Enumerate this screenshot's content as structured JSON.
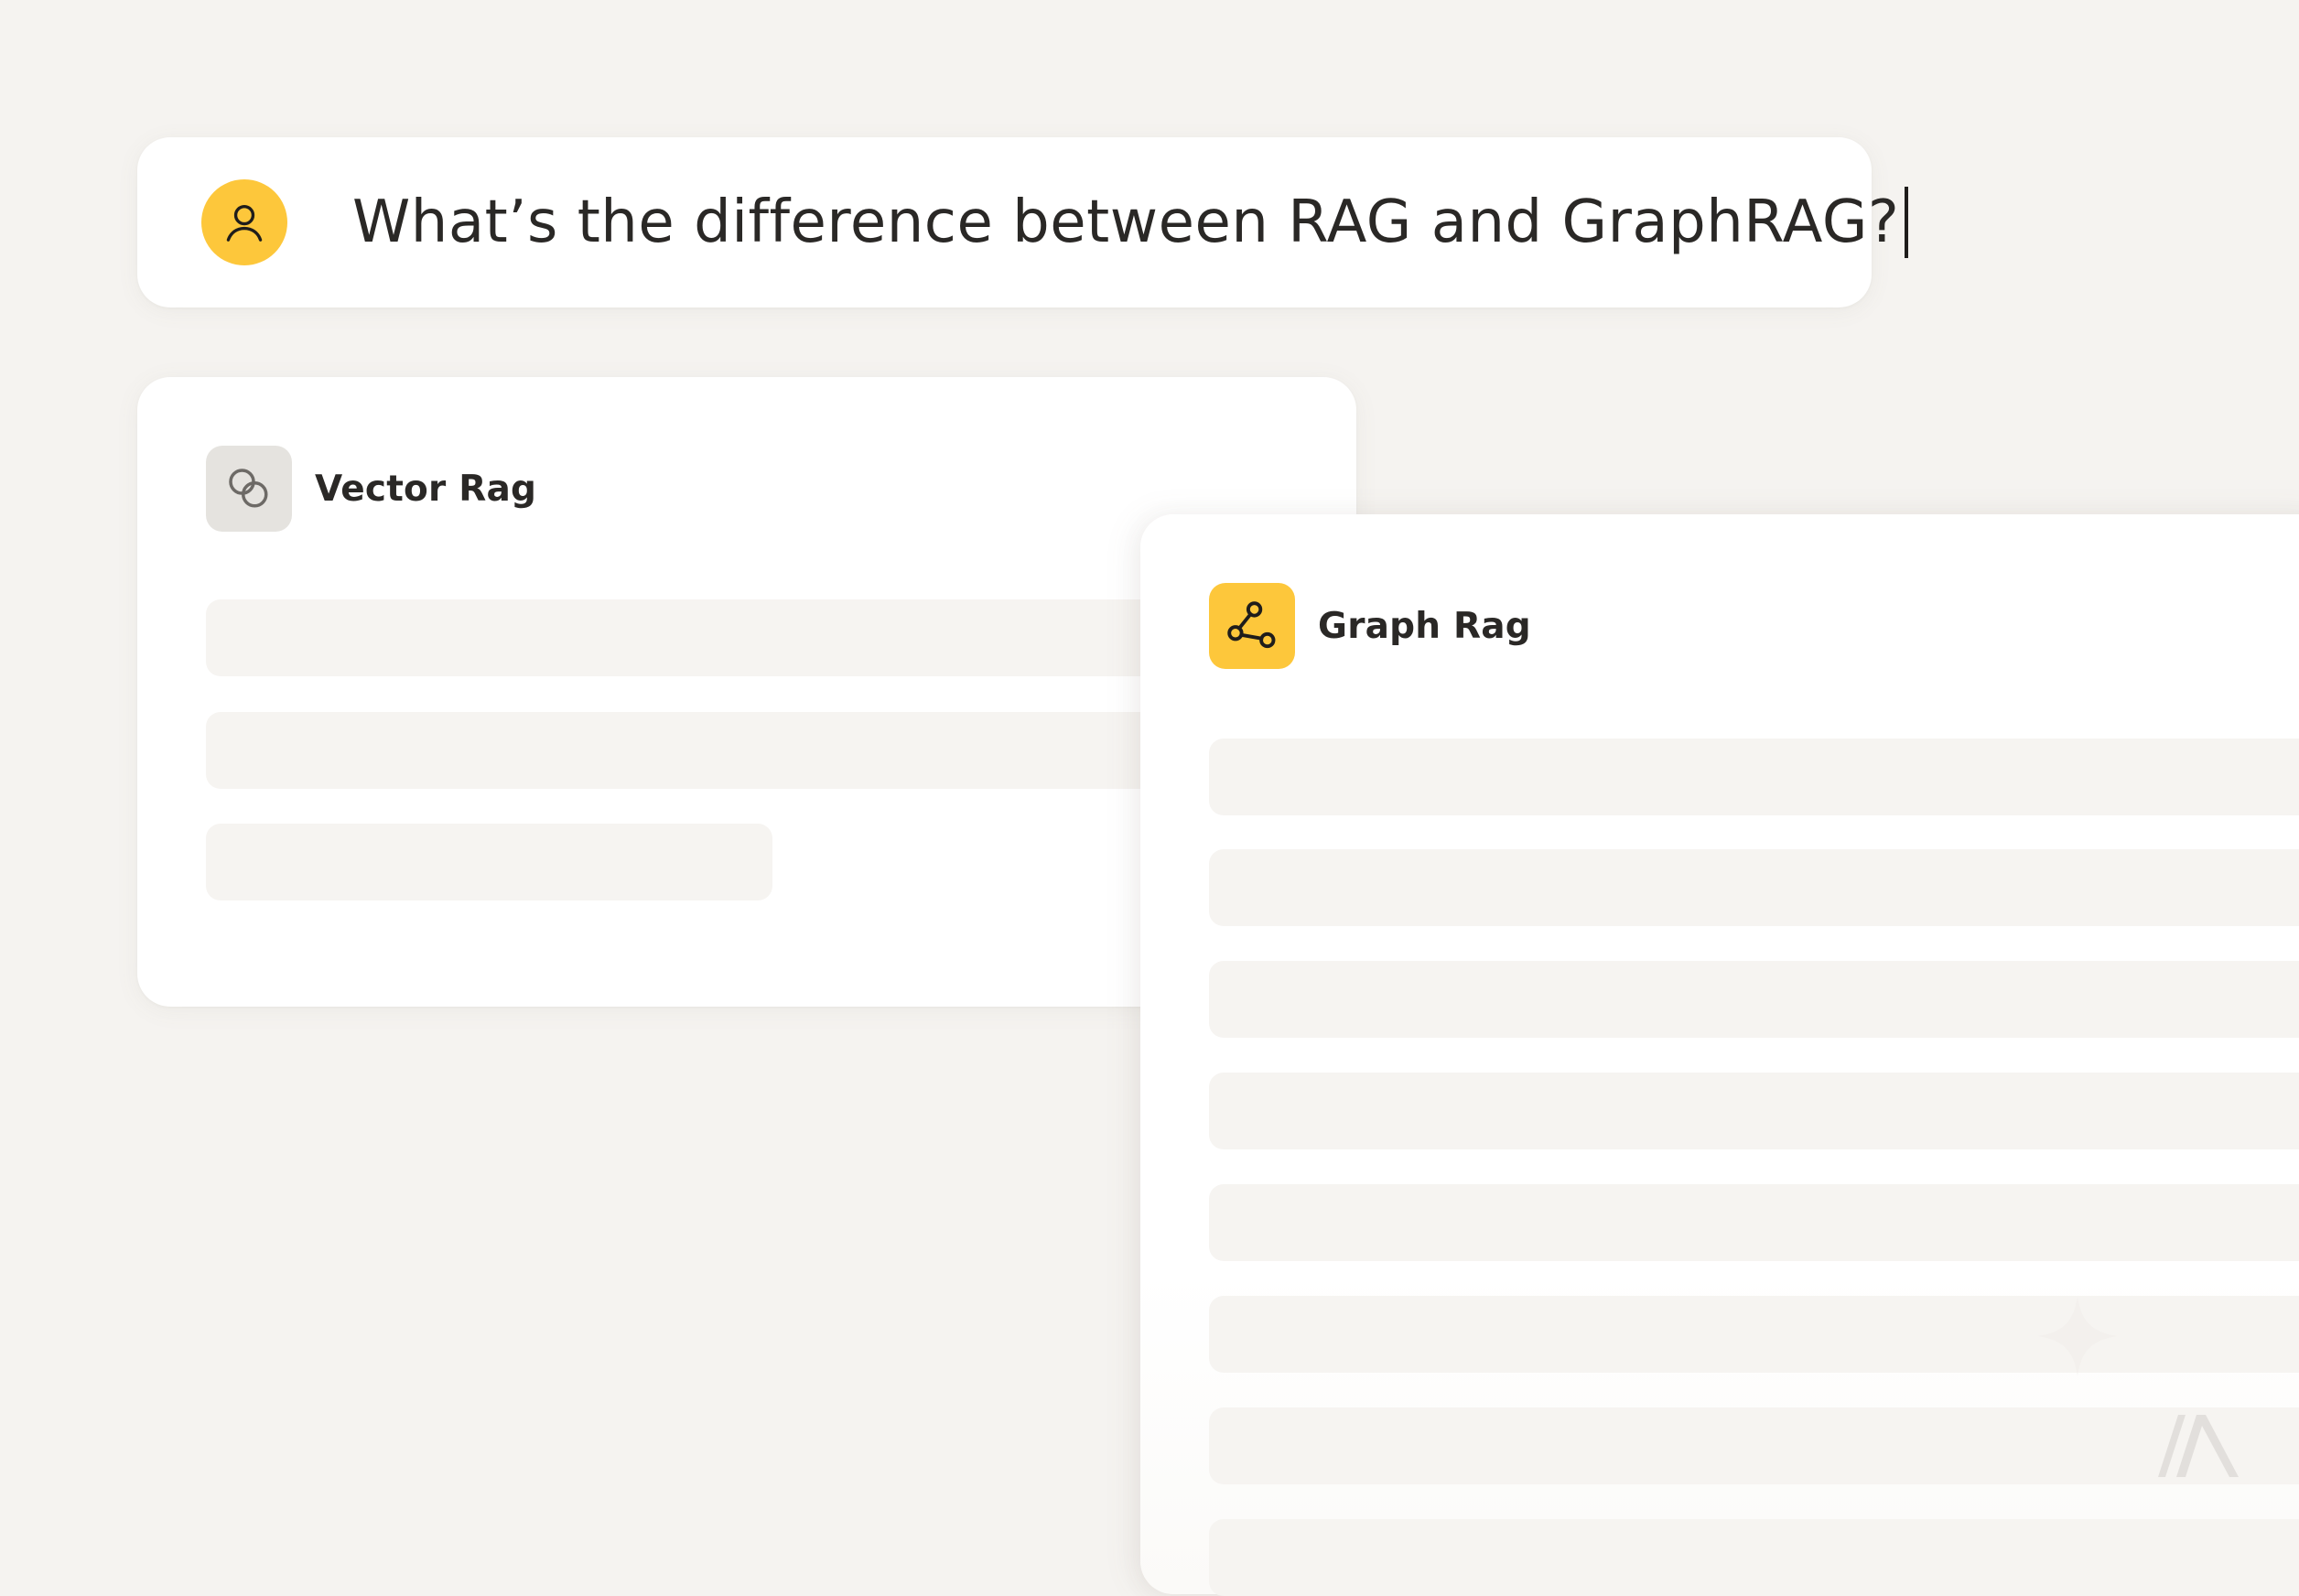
{
  "prompt": {
    "text": "What’s the difference between RAG and GraphRAG?",
    "avatar_icon": "user-icon",
    "accent_color": "#fdc73b"
  },
  "cards": {
    "vector": {
      "title": "Vector Rag",
      "icon": "overlapping-circles-icon",
      "icon_bg": "#e5e3df"
    },
    "graph": {
      "title": "Graph Rag",
      "icon": "share-nodes-icon",
      "icon_bg": "#fdc73b"
    }
  },
  "watermark": {
    "icon": "brand-logo-icon"
  }
}
